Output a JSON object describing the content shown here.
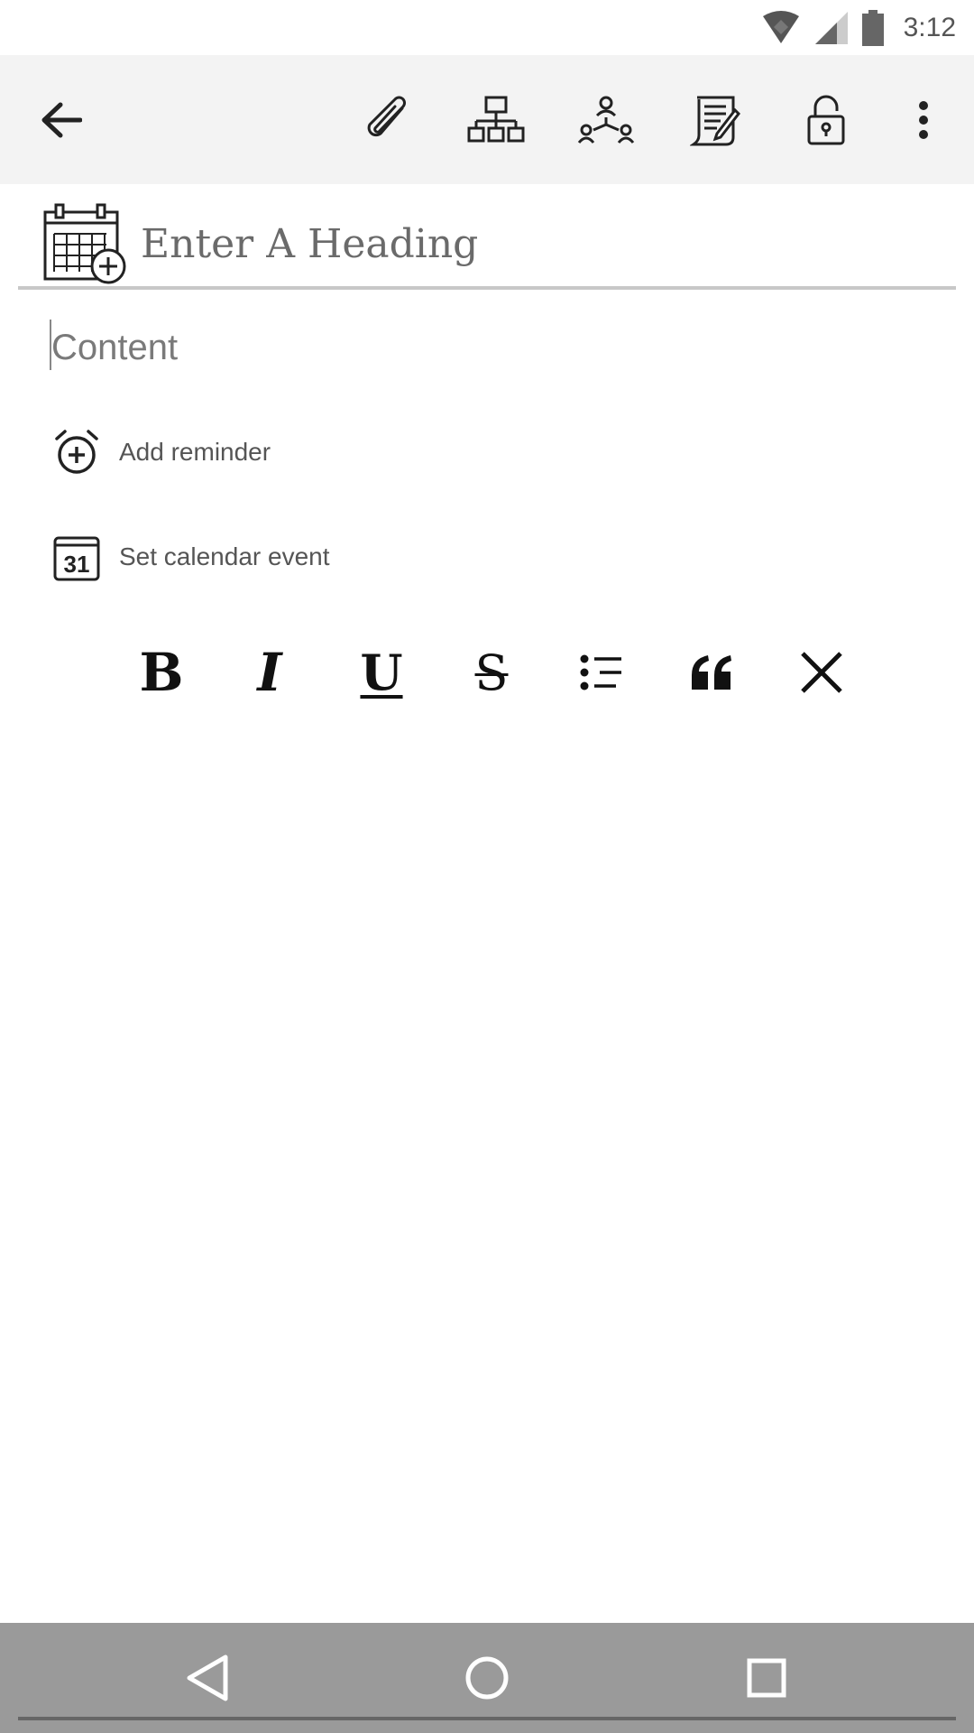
{
  "status_bar": {
    "time": "3:12",
    "icons": [
      "wifi-icon",
      "cell-signal-icon",
      "battery-icon"
    ]
  },
  "toolbar": {
    "back": "back-arrow-icon",
    "actions": [
      "paperclip-icon",
      "hierarchy-icon",
      "people-network-icon",
      "document-edit-icon",
      "unlock-icon",
      "more-vert-icon"
    ]
  },
  "editor": {
    "heading_placeholder": "Enter A Heading",
    "content_placeholder": "Content",
    "add_reminder_label": "Add reminder",
    "set_calendar_event_label": "Set calendar event",
    "calendar_day": "31"
  },
  "format_bar": {
    "bold": "B",
    "italic": "I",
    "underline": "U",
    "strike": "S",
    "list_icon": "bullet-list-icon",
    "quote_icon": "quote-icon",
    "close_icon": "close-icon"
  },
  "nav_bar": {
    "buttons": [
      "nav-back-icon",
      "nav-home-icon",
      "nav-recents-icon"
    ]
  },
  "colors": {
    "toolbar_bg": "#f3f3f3",
    "nav_bg": "#9a9a9a",
    "divider": "#c8c8c8",
    "text_muted": "#666666"
  }
}
